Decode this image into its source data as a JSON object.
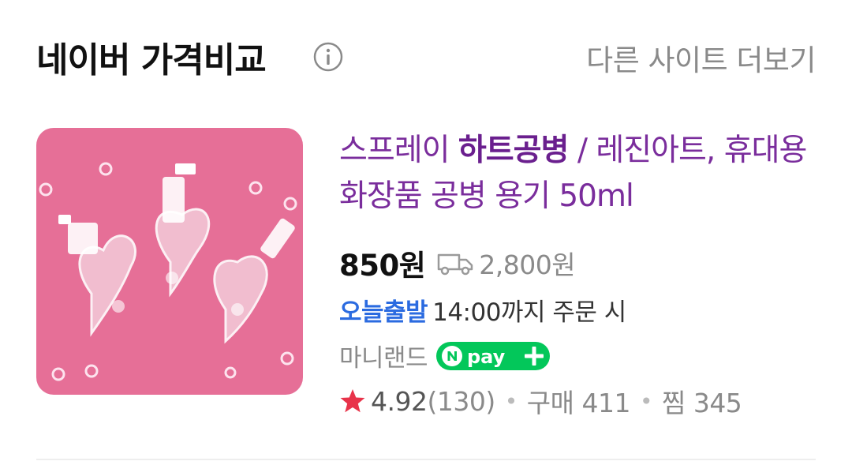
{
  "header": {
    "title": "네이버 가격비교",
    "more_link": "다른 사이트 더보기"
  },
  "product": {
    "title_prefix": "스프레이 ",
    "title_highlight": "하트공병",
    "title_suffix": " / 레진아트, 휴대용 화장품 공병 용기 50ml",
    "price": "850원",
    "shipping_fee": "2,800원",
    "delivery_badge": "오늘출발",
    "delivery_text": "14:00까지 주문 시",
    "seller": "마니랜드",
    "npay_label": "Npay+",
    "rating": "4.92",
    "review_count": "(130)",
    "purchase": "구매 411",
    "wishlist": "찜 345"
  },
  "colors": {
    "title_purple": "#7a2d9c",
    "today_blue": "#2b6be0",
    "npay_green": "#03c75a",
    "star_red": "#e8334a",
    "thumb_pink": "#e66f97"
  },
  "icons": [
    "info-icon",
    "truck-icon",
    "npay-logo",
    "star-icon"
  ]
}
